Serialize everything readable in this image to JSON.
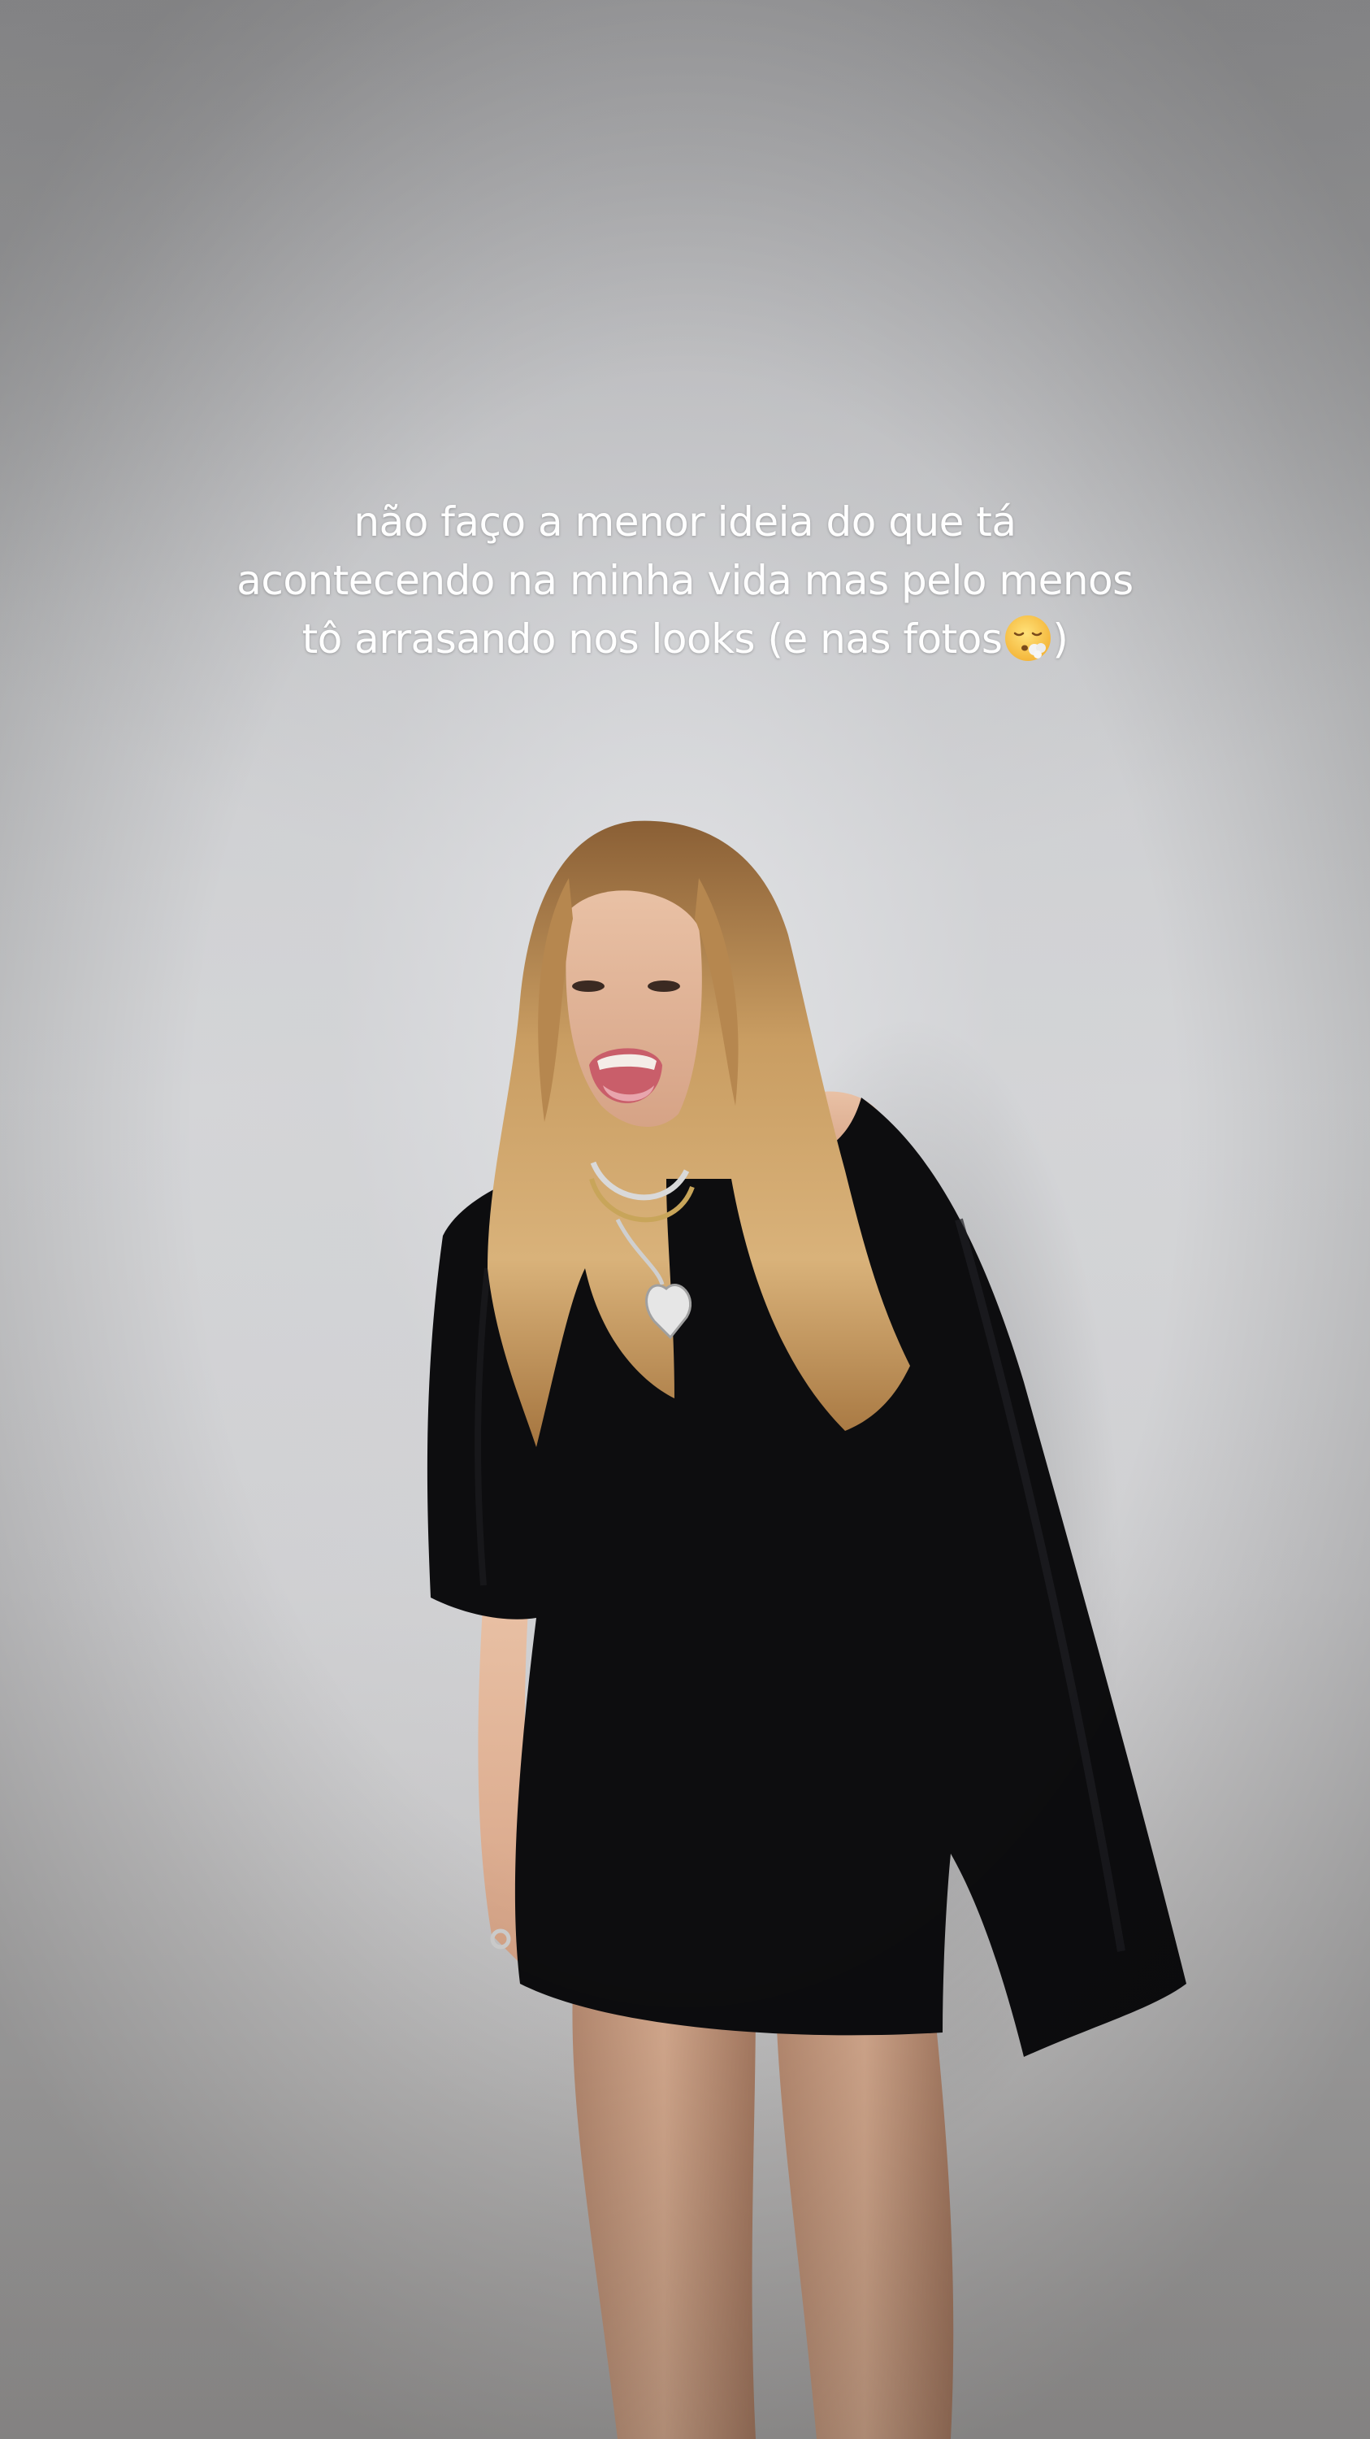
{
  "caption": {
    "line1": "não faço a menor ideia do que tá",
    "line2": "acontecendo na minha vida mas pelo menos",
    "line3_before_emoji": "tô arrasando nos looks (e nas fotos",
    "line3_after_emoji": ")",
    "emoji_icon": "face-exhaling-icon"
  },
  "colors": {
    "caption_text": "#ffffff",
    "wall": "#d5d6d8",
    "dress": "#0d0d0f",
    "hair": "#c79a5c"
  }
}
